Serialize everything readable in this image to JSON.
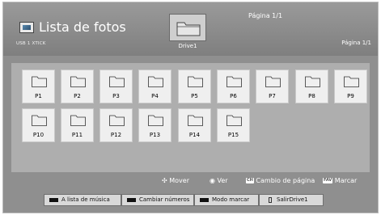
{
  "header": {
    "title": "Lista de fotos",
    "device": "USB 1 XTICK",
    "drive_label": "Drive1",
    "page_top": "Página 1/1",
    "page_right": "Página 1/1"
  },
  "folders": [
    "P1",
    "P2",
    "P3",
    "P4",
    "P5",
    "P6",
    "P7",
    "P8",
    "P9",
    "P10",
    "P11",
    "P12",
    "P13",
    "P14",
    "P15"
  ],
  "hints": {
    "move": "Mover",
    "view": "Ver",
    "ch_key": "CH",
    "page_change": "Cambio de página",
    "fav_key": "FAV",
    "mark": "Marcar"
  },
  "buttons": {
    "music": "A lista de música",
    "numbers": "Cambiar números",
    "mark_mode": "Modo marcar",
    "exit": "SalirDrive1"
  }
}
